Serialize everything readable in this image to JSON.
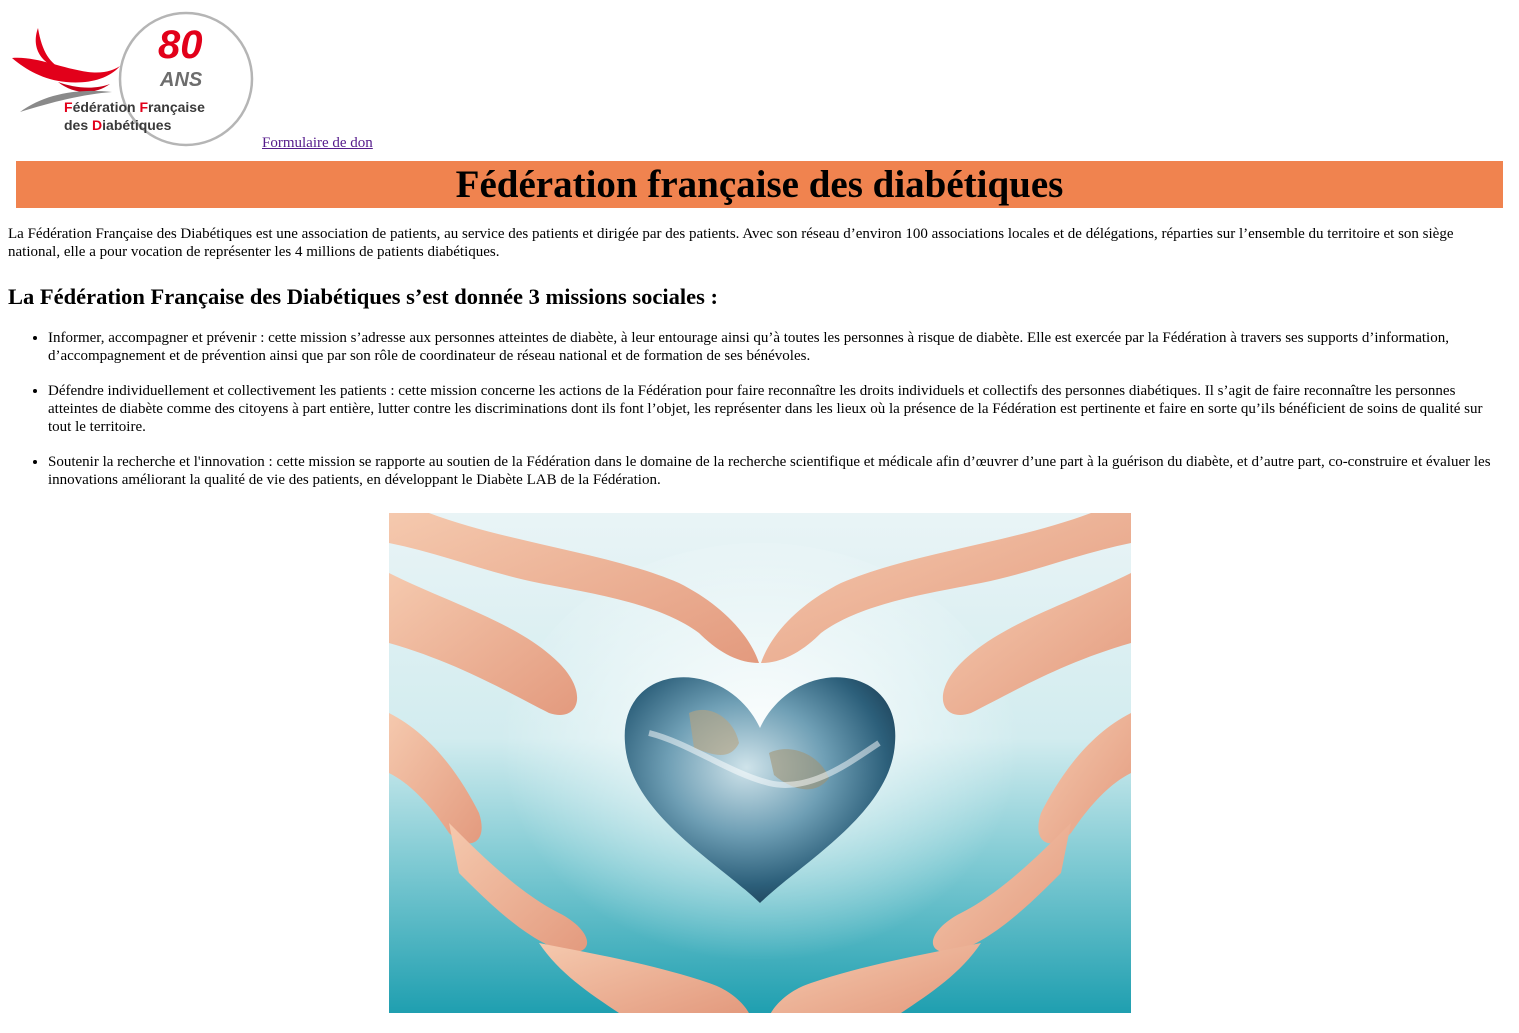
{
  "logo": {
    "anniversary_number": "80",
    "anniversary_word": "ANS",
    "org_line1_a": "F",
    "org_line1_b": "édération ",
    "org_line1_c": "F",
    "org_line1_d": "rançaise",
    "org_line2_a": "des ",
    "org_line2_b": "D",
    "org_line2_c": "iabétiques"
  },
  "header": {
    "donation_link": "Formulaire de don"
  },
  "banner": {
    "title": "Fédération française des diabétiques"
  },
  "content": {
    "intro": "La Fédération Française des Diabétiques est une association de patients, au service des patients et dirigée par des patients. Avec son réseau d’environ 100 associations locales et de délégations, réparties sur l’ensemble du territoire et son siège national, elle a pour vocation de représenter les 4 millions de patients diabétiques.",
    "missions_heading": "La Fédération Française des Diabétiques s’est donnée 3 missions sociales :",
    "missions": [
      "Informer, accompagner et prévenir : cette mission s’adresse aux personnes atteintes de diabète, à leur entourage ainsi qu’à toutes les personnes à risque de diabète. Elle est exercée par la Fédération à travers ses supports d’information, d’accompagnement et de prévention ainsi que par son rôle de coordinateur de réseau national et de formation de ses bénévoles.",
      "Défendre individuellement et collectivement les patients : cette mission concerne les actions de la Fédération pour faire reconnaître les droits individuels et collectifs des personnes diabétiques. Il s’agit de faire reconnaître les personnes atteintes de diabète comme des citoyens à part entière, lutter contre les discriminations dont ils font l’objet, les représenter dans les lieux où la présence de la Fédération est pertinente et faire en sorte qu’ils bénéficient de soins de qualité sur tout le territoire.",
      "Soutenir la recherche et l'innovation : cette mission se rapporte au soutien de la Fédération dans le domaine de la recherche scientifique et médicale afin d’œuvrer d’une part à la guérison du diabète, et d’autre part, co-construire et évaluer les innovations améliorant la qualité de vie des patients, en développant le Diabète LAB de la Fédération."
    ]
  },
  "colors": {
    "banner_bg": "#f0834f",
    "logo_red": "#e2001a",
    "logo_grey": "#8a8a8a",
    "visited_link": "#551a8b"
  },
  "icons": {
    "logo": "federation-bird-logo",
    "illustration": "hands-heart-earth-image"
  }
}
